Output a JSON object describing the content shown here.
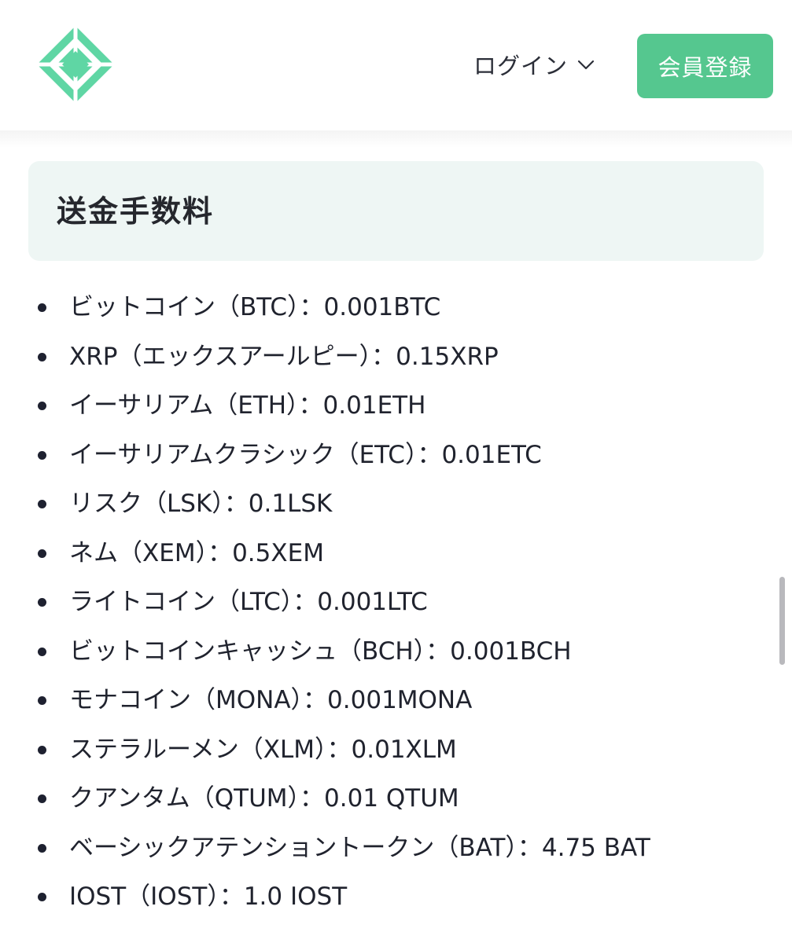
{
  "header": {
    "logo_icon": "diamond-logo-icon",
    "login_label": "ログイン",
    "login_chevron_icon": "chevron-down-icon",
    "signup_label": "会員登録"
  },
  "section": {
    "title": "送金手数料"
  },
  "fees": [
    {
      "text": "ビットコイン（BTC）：0.001BTC"
    },
    {
      "text": "XRP（エックスアールピー）：0.15XRP"
    },
    {
      "text": "イーサリアム（ETH）：0.01ETH"
    },
    {
      "text": "イーサリアムクラシック（ETC）：0.01ETC"
    },
    {
      "text": "リスク（LSK）：0.1LSK"
    },
    {
      "text": "ネム（XEM）：0.5XEM"
    },
    {
      "text": "ライトコイン（LTC）：0.001LTC"
    },
    {
      "text": "ビットコインキャッシュ（BCH）：0.001BCH"
    },
    {
      "text": "モナコイン（MONA）：0.001MONA"
    },
    {
      "text": "ステラルーメン（XLM）：0.01XLM"
    },
    {
      "text": "クアンタム（QTUM）：0.01 QTUM"
    },
    {
      "text": "ベーシックアテンショントークン（BAT）：4.75 BAT"
    },
    {
      "text": "IOST（IOST）：1.0 IOST"
    }
  ],
  "colors": {
    "brand_green": "#55c78f",
    "logo_green": "#5fd6a4",
    "section_bg": "#eef6f4",
    "text_dark": "#20232e"
  }
}
